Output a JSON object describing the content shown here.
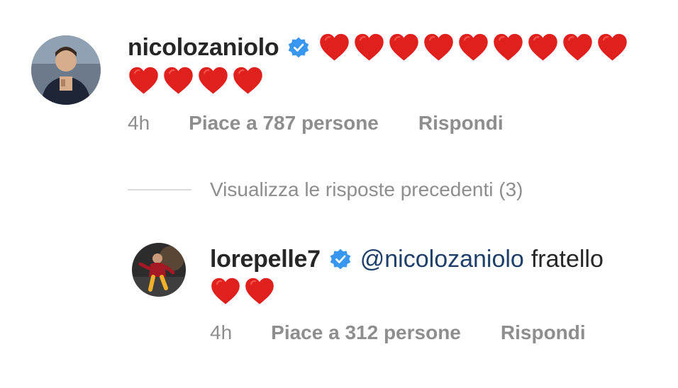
{
  "comments": [
    {
      "username": "nicolozaniolo",
      "verified": true,
      "hearts_line1": 9,
      "hearts_line2": 4,
      "time": "4h",
      "likes": "Piace a 787 persone",
      "reply": "Rispondi"
    },
    {
      "username": "lorepelle7",
      "verified": true,
      "mention": "@nicolozaniolo",
      "text": "fratello",
      "hearts_line2": 2,
      "time": "4h",
      "likes": "Piace a 312 persone",
      "reply": "Rispondi"
    }
  ],
  "view_replies": "Visualizza le risposte precedenti (3)",
  "colors": {
    "heart": "#e0201d",
    "verified": "#3897f0",
    "meta": "#8e8e8e",
    "mention": "#1d3f6b"
  }
}
